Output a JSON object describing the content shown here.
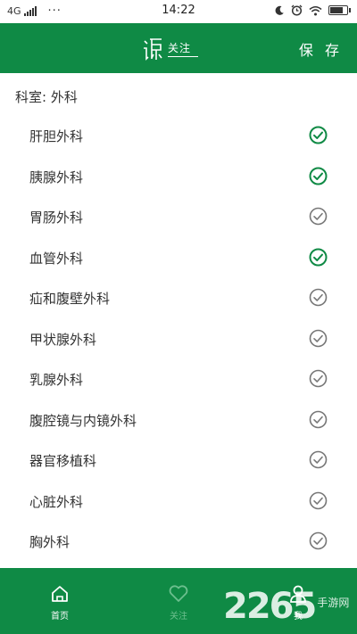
{
  "status_bar": {
    "network": "4G",
    "dots": "···",
    "time": "14:22"
  },
  "header": {
    "logo_text": "关注",
    "save_label": "保 存"
  },
  "department": {
    "label": "科室: 外科"
  },
  "colors": {
    "brand_green": "#0f8a45",
    "checked": "#0f8a45",
    "unchecked": "#777777"
  },
  "specialties": [
    {
      "name": "肝胆外科",
      "checked": true
    },
    {
      "name": "胰腺外科",
      "checked": true
    },
    {
      "name": "胃肠外科",
      "checked": false
    },
    {
      "name": "血管外科",
      "checked": true
    },
    {
      "name": "疝和腹壁外科",
      "checked": false
    },
    {
      "name": "甲状腺外科",
      "checked": false
    },
    {
      "name": "乳腺外科",
      "checked": false
    },
    {
      "name": "腹腔镜与内镜外科",
      "checked": false
    },
    {
      "name": "器官移植科",
      "checked": false
    },
    {
      "name": "心脏外科",
      "checked": false
    },
    {
      "name": "胸外科",
      "checked": false
    }
  ],
  "tabbar": {
    "home": "首页",
    "follow": "关注",
    "me": "我"
  },
  "watermark": {
    "number": "2265",
    "site": "手游网"
  }
}
